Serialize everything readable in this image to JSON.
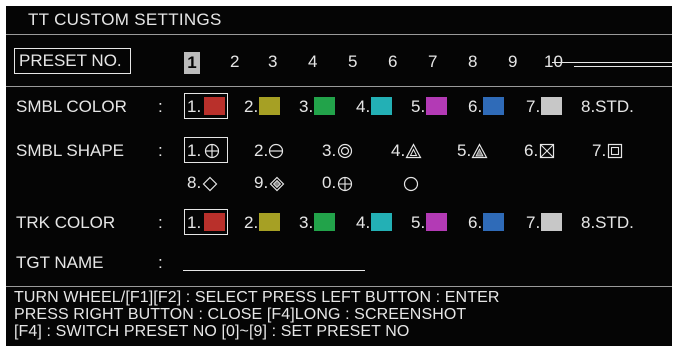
{
  "title": "TT CUSTOM SETTINGS",
  "preset": {
    "label": "PRESET NO.",
    "selected": "1",
    "numbers": [
      "2",
      "3",
      "4",
      "5",
      "6",
      "7",
      "8",
      "9",
      "10"
    ]
  },
  "symbol_color": {
    "label": "SMBL COLOR",
    "colon": ":",
    "options": [
      {
        "num": "1.",
        "color": "#b9302b"
      },
      {
        "num": "2.",
        "color": "#a6a024"
      },
      {
        "num": "3.",
        "color": "#22a34a"
      },
      {
        "num": "4.",
        "color": "#23b0b5"
      },
      {
        "num": "5.",
        "color": "#b33ab5"
      },
      {
        "num": "6.",
        "color": "#2f6bb8"
      },
      {
        "num": "7.",
        "color": "#c7c7c7"
      }
    ],
    "std": "8.STD."
  },
  "symbol_shape": {
    "label": "SMBL SHAPE",
    "colon": ":",
    "options": [
      {
        "num": "1.",
        "icon": "circle-plus-icon"
      },
      {
        "num": "2.",
        "icon": "circle-minus-icon"
      },
      {
        "num": "3.",
        "icon": "double-circle-icon"
      },
      {
        "num": "4.",
        "icon": "triangle-icon"
      },
      {
        "num": "5.",
        "icon": "filled-triangle-icon"
      },
      {
        "num": "6.",
        "icon": "square-x-icon"
      },
      {
        "num": "7.",
        "icon": "double-square-icon"
      },
      {
        "num": "8.",
        "icon": "diamond-icon"
      },
      {
        "num": "9.",
        "icon": "double-diamond-icon"
      },
      {
        "num": "0.",
        "icon": "circle-cross-icon"
      },
      {
        "num": "",
        "icon": "circle-icon"
      }
    ]
  },
  "track_color": {
    "label": "TRK COLOR",
    "colon": ":",
    "options": [
      {
        "num": "1.",
        "color": "#b9302b"
      },
      {
        "num": "2.",
        "color": "#a6a024"
      },
      {
        "num": "3.",
        "color": "#22a34a"
      },
      {
        "num": "4.",
        "color": "#23b0b5"
      },
      {
        "num": "5.",
        "color": "#b33ab5"
      },
      {
        "num": "6.",
        "color": "#2f6bb8"
      },
      {
        "num": "7.",
        "color": "#c7c7c7"
      }
    ],
    "std": "8.STD."
  },
  "target_name": {
    "label": "TGT NAME",
    "colon": ":",
    "value": ""
  },
  "help": {
    "line1": "TURN WHEEL/[F1][F2] : SELECT    PRESS LEFT BUTTON : ENTER",
    "line2": "PRESS RIGHT BUTTON : CLOSE    [F4]LONG : SCREENSHOT",
    "line3": "[F4] : SWITCH PRESET NO    [0]~[9] : SET PRESET NO"
  }
}
